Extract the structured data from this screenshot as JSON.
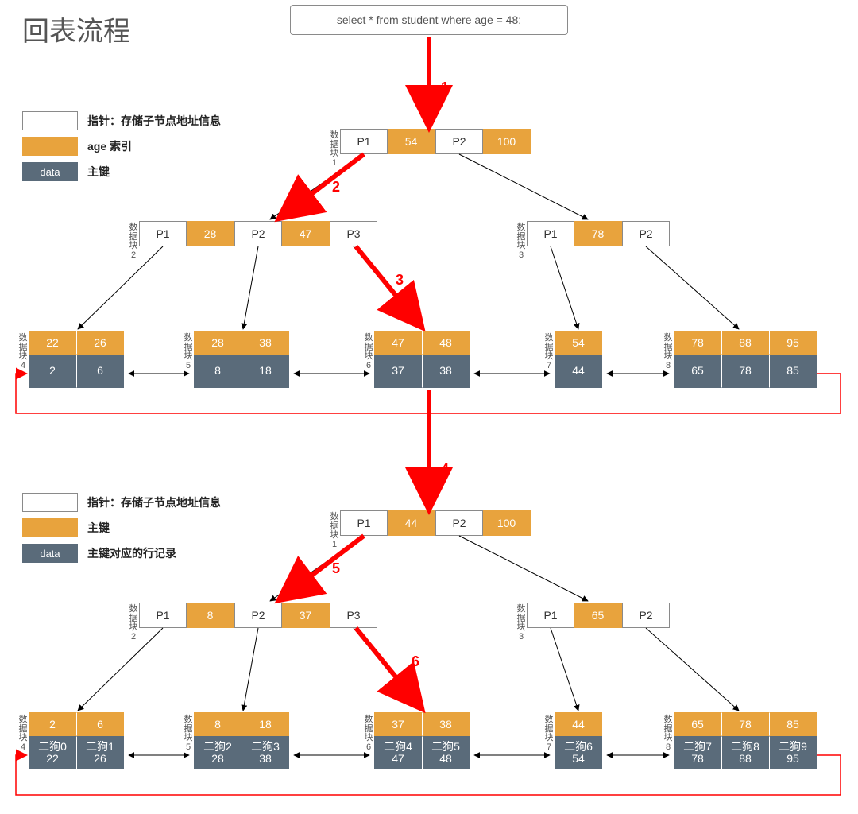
{
  "title": "回表流程",
  "sql": "select * from student where age = 48;",
  "legend1": {
    "pointer": "指针：存储子节点地址信息",
    "index": "age 索引",
    "data_label": "data",
    "pk": "主键"
  },
  "legend2": {
    "pointer": "指针：存储子节点地址信息",
    "pk": "主键",
    "data_label": "data",
    "row": "主键对应的行记录"
  },
  "steps": {
    "s1": "1",
    "s2": "2",
    "s3": "3",
    "s4": "4",
    "s5": "5",
    "s6": "6"
  },
  "blk": {
    "b1": "数据块1",
    "b2": "数据块2",
    "b3": "数据块3",
    "b4": "数据块4",
    "b5": "数据块5",
    "b6": "数据块6",
    "b7": "数据块7",
    "b8": "数据块8"
  },
  "t1": {
    "root": {
      "p1": "P1",
      "v1": "54",
      "p2": "P2",
      "v2": "100"
    },
    "left": {
      "p1": "P1",
      "v1": "28",
      "p2": "P2",
      "v2": "47",
      "p3": "P3"
    },
    "right": {
      "p1": "P1",
      "v1": "78",
      "p2": "P2"
    },
    "leaf4": {
      "k": [
        "22",
        "26"
      ],
      "v": [
        "2",
        "6"
      ]
    },
    "leaf5": {
      "k": [
        "28",
        "38"
      ],
      "v": [
        "8",
        "18"
      ]
    },
    "leaf6": {
      "k": [
        "47",
        "48"
      ],
      "v": [
        "37",
        "38"
      ]
    },
    "leaf7": {
      "k": [
        "54"
      ],
      "v": [
        "44"
      ]
    },
    "leaf8": {
      "k": [
        "78",
        "88",
        "95"
      ],
      "v": [
        "65",
        "78",
        "85"
      ]
    }
  },
  "t2": {
    "root": {
      "p1": "P1",
      "v1": "44",
      "p2": "P2",
      "v2": "100"
    },
    "left": {
      "p1": "P1",
      "v1": "8",
      "p2": "P2",
      "v2": "37",
      "p3": "P3"
    },
    "right": {
      "p1": "P1",
      "v1": "65",
      "p2": "P2"
    },
    "leaf4": {
      "k": [
        "2",
        "6"
      ],
      "n": [
        "二狗0",
        "二狗1"
      ],
      "v": [
        "22",
        "26"
      ]
    },
    "leaf5": {
      "k": [
        "8",
        "18"
      ],
      "n": [
        "二狗2",
        "二狗3"
      ],
      "v": [
        "28",
        "38"
      ]
    },
    "leaf6": {
      "k": [
        "37",
        "38"
      ],
      "n": [
        "二狗4",
        "二狗5"
      ],
      "v": [
        "47",
        "48"
      ]
    },
    "leaf7": {
      "k": [
        "44"
      ],
      "n": [
        "二狗6"
      ],
      "v": [
        "54"
      ]
    },
    "leaf8": {
      "k": [
        "65",
        "78",
        "85"
      ],
      "n": [
        "二狗7",
        "二狗8",
        "二狗9"
      ],
      "v": [
        "78",
        "88",
        "95"
      ]
    }
  }
}
